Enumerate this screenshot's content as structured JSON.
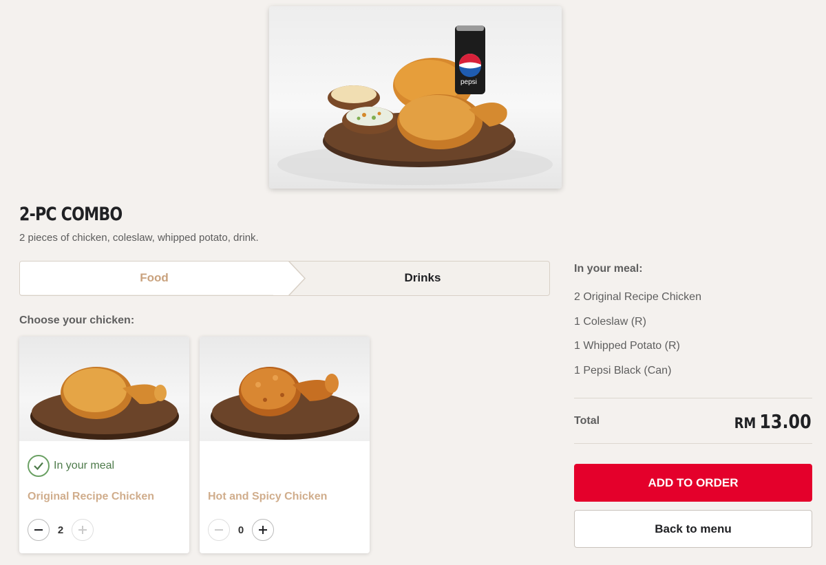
{
  "product": {
    "title": "2-PC COMBO",
    "description": "2 pieces of chicken, coleslaw, whipped potato, drink.",
    "image_alt": "pepsi"
  },
  "tabs": [
    {
      "label": "Food",
      "active": true
    },
    {
      "label": "Drinks",
      "active": false
    }
  ],
  "choose_label": "Choose your chicken:",
  "options": [
    {
      "name": "Original Recipe Chicken",
      "in_meal": true,
      "in_meal_label": "In your meal",
      "quantity": "2",
      "decrease_icon": "minus-icon",
      "increase_icon": "plus-icon"
    },
    {
      "name": "Hot and Spicy Chicken",
      "in_meal": false,
      "in_meal_label": "",
      "quantity": "0",
      "decrease_icon": "minus-icon",
      "increase_icon": "plus-icon"
    }
  ],
  "summary": {
    "heading": "In your meal:",
    "items": [
      "2 Original Recipe Chicken",
      "1 Coleslaw (R)",
      "1 Whipped Potato (R)",
      "1 Pepsi Black (Can)"
    ],
    "total_label": "Total",
    "currency": "RM",
    "total_amount": "13.00"
  },
  "buttons": {
    "add_to_order": "ADD TO ORDER",
    "back_to_menu": "Back to menu"
  },
  "colors": {
    "brand_red": "#e4002b",
    "accent_tan": "#d0ad8c",
    "check_green": "#6aa063"
  }
}
